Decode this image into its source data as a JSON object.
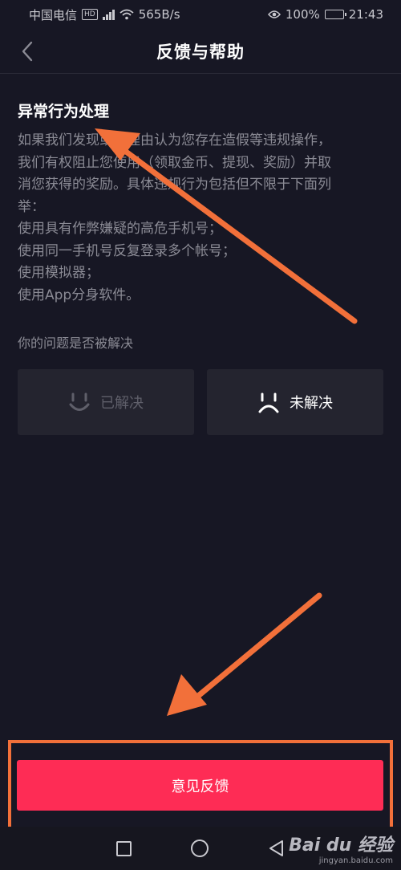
{
  "status_bar": {
    "carrier": "中国电信",
    "network_badge": "HD",
    "speed": "565B/s",
    "battery": "100%",
    "time": "21:43",
    "icons": [
      "signal-icon",
      "wifi-icon",
      "eye-icon",
      "battery-icon"
    ]
  },
  "header": {
    "title": "反馈与帮助",
    "back_icon": "chevron-left-icon"
  },
  "content": {
    "section_title": "异常行为处理",
    "paragraph_lines": [
      "如果我们发现或有理由认为您存在造假等违规操作，",
      "我们有权阻止您使用（领取金币、提现、奖励）并取",
      "消您获得的奖励。具体违规行为包括但不限于下面列",
      "举：",
      "使用具有作弊嫌疑的高危手机号；",
      "使用同一手机号反复登录多个帐号；",
      "使用模拟器；",
      "使用App分身软件。"
    ],
    "question": "你的问题是否被解决",
    "resolved_label": "已解决",
    "unresolved_label": "未解决"
  },
  "actions": {
    "feedback_label": "意见反馈"
  },
  "watermark": {
    "main": "Bai du 经验",
    "sub": "jingyan.baidu.com"
  },
  "colors": {
    "background": "#171724",
    "accent": "#fe2c55",
    "annotation": "#f2703a",
    "muted_text": "#8b8b95"
  }
}
